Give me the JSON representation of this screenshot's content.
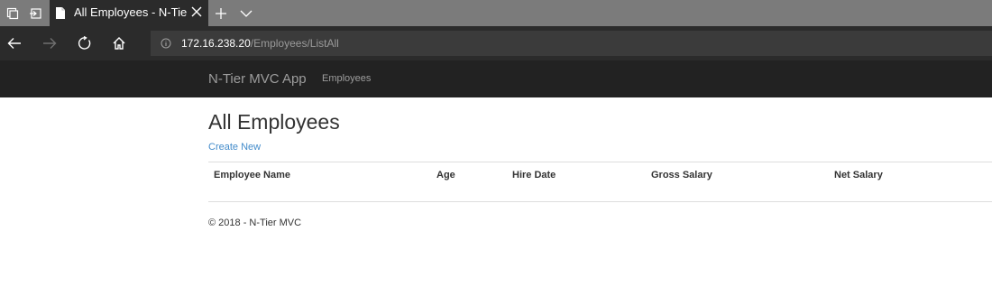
{
  "browser": {
    "tab_title": "All Employees - N-Tier MVC App",
    "url_host": "172.16.238.20",
    "url_path": "/Employees/ListAll",
    "icons": {
      "tab_actions": "tab-actions-icon",
      "set_aside": "set-aside-tabs-icon",
      "page": "page-icon",
      "close": "close-icon",
      "new_tab": "plus-icon",
      "tab_list": "chevron-down-icon",
      "back": "back-arrow-icon",
      "forward": "forward-arrow-icon",
      "refresh": "refresh-icon",
      "home": "home-icon",
      "info": "info-icon"
    }
  },
  "app": {
    "brand": "N-Tier MVC App",
    "nav_items": [
      {
        "label": "Employees"
      }
    ]
  },
  "main": {
    "title": "All Employees",
    "create_link": "Create New",
    "table": {
      "columns": [
        "Employee Name",
        "Age",
        "Hire Date",
        "Gross Salary",
        "Net Salary"
      ],
      "rows": []
    }
  },
  "footer": {
    "text": "© 2018 - N-Tier MVC"
  },
  "colors": {
    "tabstrip": "#7b7b7b",
    "chrome": "#2b2b2b",
    "navbar": "#222222",
    "link": "#428bca",
    "text": "#333333"
  }
}
